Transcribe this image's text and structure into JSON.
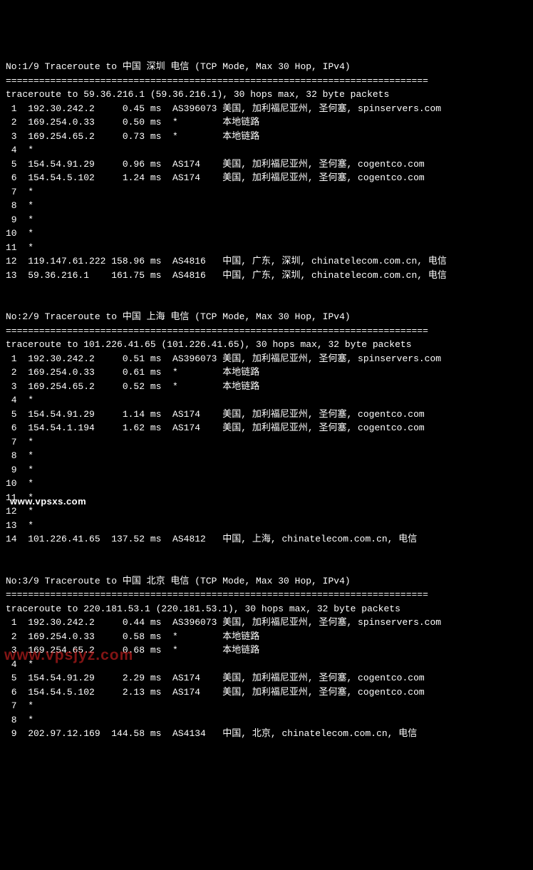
{
  "sections": [
    {
      "header": "No:1/9 Traceroute to 中国 深圳 电信 (TCP Mode, Max 30 Hop, IPv4)",
      "divider": "============================================================================",
      "intro": "traceroute to 59.36.216.1 (59.36.216.1), 30 hops max, 32 byte packets",
      "hops": [
        {
          "n": "1",
          "ip": "192.30.242.2",
          "ms": "0.45 ms",
          "asn": "AS396073",
          "loc": "美国, 加利福尼亚州, 圣何塞, spinservers.com"
        },
        {
          "n": "2",
          "ip": "169.254.0.33",
          "ms": "0.50 ms",
          "asn": "*",
          "loc": "本地链路"
        },
        {
          "n": "3",
          "ip": "169.254.65.2",
          "ms": "0.73 ms",
          "asn": "*",
          "loc": "本地链路"
        },
        {
          "n": "4",
          "ip": "*",
          "ms": "",
          "asn": "",
          "loc": ""
        },
        {
          "n": "5",
          "ip": "154.54.91.29",
          "ms": "0.96 ms",
          "asn": "AS174",
          "loc": "美国, 加利福尼亚州, 圣何塞, cogentco.com"
        },
        {
          "n": "6",
          "ip": "154.54.5.102",
          "ms": "1.24 ms",
          "asn": "AS174",
          "loc": "美国, 加利福尼亚州, 圣何塞, cogentco.com"
        },
        {
          "n": "7",
          "ip": "*",
          "ms": "",
          "asn": "",
          "loc": ""
        },
        {
          "n": "8",
          "ip": "*",
          "ms": "",
          "asn": "",
          "loc": ""
        },
        {
          "n": "9",
          "ip": "*",
          "ms": "",
          "asn": "",
          "loc": ""
        },
        {
          "n": "10",
          "ip": "*",
          "ms": "",
          "asn": "",
          "loc": ""
        },
        {
          "n": "11",
          "ip": "*",
          "ms": "",
          "asn": "",
          "loc": ""
        },
        {
          "n": "12",
          "ip": "119.147.61.222",
          "ms": "158.96 ms",
          "asn": "AS4816",
          "loc": "中国, 广东, 深圳, chinatelecom.com.cn, 电信"
        },
        {
          "n": "13",
          "ip": "59.36.216.1",
          "ms": "161.75 ms",
          "asn": "AS4816",
          "loc": "中国, 广东, 深圳, chinatelecom.com.cn, 电信"
        }
      ]
    },
    {
      "header": "No:2/9 Traceroute to 中国 上海 电信 (TCP Mode, Max 30 Hop, IPv4)",
      "divider": "============================================================================",
      "intro": "traceroute to 101.226.41.65 (101.226.41.65), 30 hops max, 32 byte packets",
      "hops": [
        {
          "n": "1",
          "ip": "192.30.242.2",
          "ms": "0.51 ms",
          "asn": "AS396073",
          "loc": "美国, 加利福尼亚州, 圣何塞, spinservers.com"
        },
        {
          "n": "2",
          "ip": "169.254.0.33",
          "ms": "0.61 ms",
          "asn": "*",
          "loc": "本地链路"
        },
        {
          "n": "3",
          "ip": "169.254.65.2",
          "ms": "0.52 ms",
          "asn": "*",
          "loc": "本地链路"
        },
        {
          "n": "4",
          "ip": "*",
          "ms": "",
          "asn": "",
          "loc": ""
        },
        {
          "n": "5",
          "ip": "154.54.91.29",
          "ms": "1.14 ms",
          "asn": "AS174",
          "loc": "美国, 加利福尼亚州, 圣何塞, cogentco.com"
        },
        {
          "n": "6",
          "ip": "154.54.1.194",
          "ms": "1.62 ms",
          "asn": "AS174",
          "loc": "美国, 加利福尼亚州, 圣何塞, cogentco.com"
        },
        {
          "n": "7",
          "ip": "*",
          "ms": "",
          "asn": "",
          "loc": ""
        },
        {
          "n": "8",
          "ip": "*",
          "ms": "",
          "asn": "",
          "loc": ""
        },
        {
          "n": "9",
          "ip": "*",
          "ms": "",
          "asn": "",
          "loc": ""
        },
        {
          "n": "10",
          "ip": "*",
          "ms": "",
          "asn": "",
          "loc": ""
        },
        {
          "n": "11",
          "ip": "*",
          "ms": "",
          "asn": "",
          "loc": ""
        },
        {
          "n": "12",
          "ip": "*",
          "ms": "",
          "asn": "",
          "loc": ""
        },
        {
          "n": "13",
          "ip": "*",
          "ms": "",
          "asn": "",
          "loc": ""
        },
        {
          "n": "14",
          "ip": "101.226.41.65",
          "ms": "137.52 ms",
          "asn": "AS4812",
          "loc": "中国, 上海, chinatelecom.com.cn, 电信"
        }
      ]
    },
    {
      "header": "No:3/9 Traceroute to 中国 北京 电信 (TCP Mode, Max 30 Hop, IPv4)",
      "divider": "============================================================================",
      "intro": "traceroute to 220.181.53.1 (220.181.53.1), 30 hops max, 32 byte packets",
      "hops": [
        {
          "n": "1",
          "ip": "192.30.242.2",
          "ms": "0.44 ms",
          "asn": "AS396073",
          "loc": "美国, 加利福尼亚州, 圣何塞, spinservers.com"
        },
        {
          "n": "2",
          "ip": "169.254.0.33",
          "ms": "0.58 ms",
          "asn": "*",
          "loc": "本地链路"
        },
        {
          "n": "3",
          "ip": "169.254.65.2",
          "ms": "0.68 ms",
          "asn": "*",
          "loc": "本地链路"
        },
        {
          "n": "4",
          "ip": "*",
          "ms": "",
          "asn": "",
          "loc": ""
        },
        {
          "n": "5",
          "ip": "154.54.91.29",
          "ms": "2.29 ms",
          "asn": "AS174",
          "loc": "美国, 加利福尼亚州, 圣何塞, cogentco.com"
        },
        {
          "n": "6",
          "ip": "154.54.5.102",
          "ms": "2.13 ms",
          "asn": "AS174",
          "loc": "美国, 加利福尼亚州, 圣何塞, cogentco.com"
        },
        {
          "n": "7",
          "ip": "*",
          "ms": "",
          "asn": "",
          "loc": ""
        },
        {
          "n": "8",
          "ip": "*",
          "ms": "",
          "asn": "",
          "loc": ""
        },
        {
          "n": "9",
          "ip": "202.97.12.169",
          "ms": "144.58 ms",
          "asn": "AS4134",
          "loc": "中国, 北京, chinatelecom.com.cn, 电信"
        }
      ]
    }
  ],
  "watermarks": {
    "w1": "www.vpsxs.com",
    "w2": "www.vpsjyz.com"
  }
}
